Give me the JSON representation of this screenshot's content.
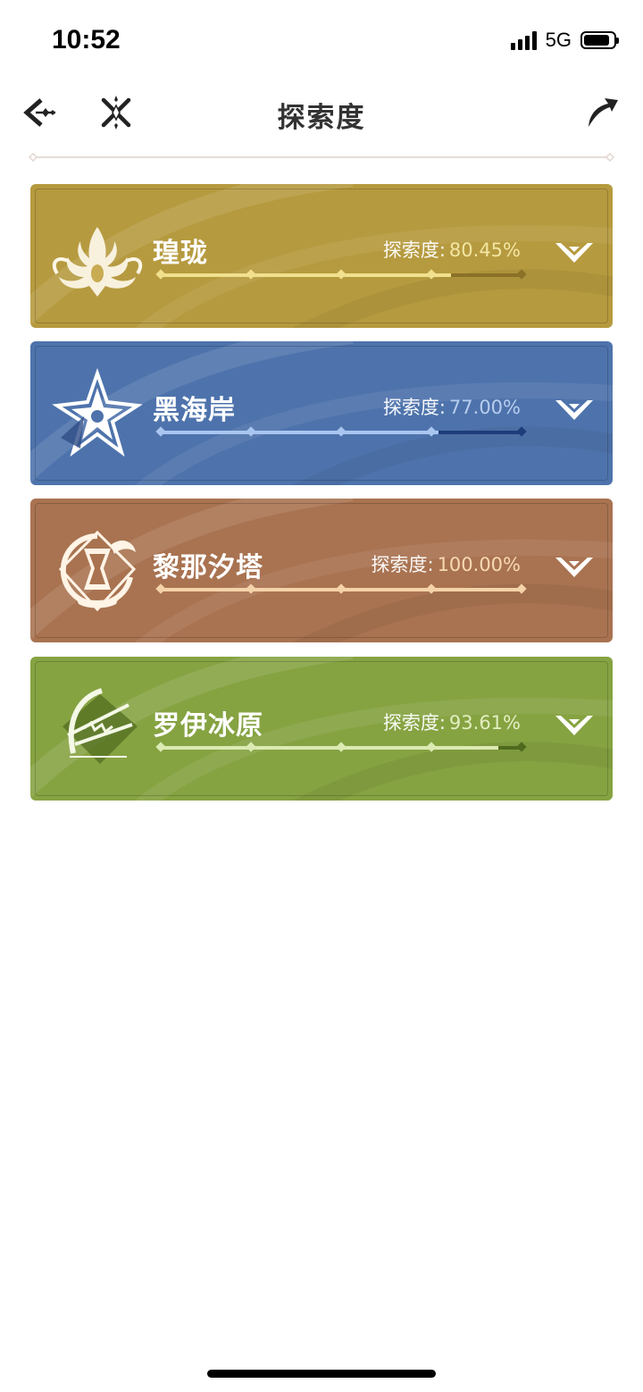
{
  "status_bar": {
    "time": "10:52",
    "network": "5G"
  },
  "nav": {
    "title": "探索度",
    "back_icon": "back-arrow-icon",
    "close_icon": "close-x-icon",
    "share_icon": "share-arrow-icon"
  },
  "regions": [
    {
      "name": "瑝珑",
      "progress_label": "探索度:",
      "progress_value": "80.45%",
      "progress": 0.8045,
      "emblem_icon": "dragon-emblem-icon",
      "colors": {
        "bg": "#B69A3F",
        "fill": "#F1E08D",
        "track": "#8A7127",
        "value": "#F2E6A3"
      }
    },
    {
      "name": "黑海岸",
      "progress_label": "探索度:",
      "progress_value": "77.00%",
      "progress": 0.77,
      "emblem_icon": "star-flower-emblem-icon",
      "colors": {
        "bg": "#4E73AC",
        "fill": "#A9C6F0",
        "track": "#1E3C7A",
        "value": "#B7CDEE"
      }
    },
    {
      "name": "黎那汐塔",
      "progress_label": "探索度:",
      "progress_value": "100.00%",
      "progress": 1.0,
      "emblem_icon": "hourglass-emblem-icon",
      "colors": {
        "bg": "#A97351",
        "fill": "#F5D3A8",
        "track": "#7B4B30",
        "value": "#F7D9B3"
      }
    },
    {
      "name": "罗伊冰原",
      "progress_label": "探索度:",
      "progress_value": "93.61%",
      "progress": 0.9361,
      "emblem_icon": "crossbow-emblem-icon",
      "colors": {
        "bg": "#86A342",
        "fill": "#DCEAB3",
        "track": "#4F6A1E",
        "value": "#E3EEC0"
      }
    }
  ]
}
